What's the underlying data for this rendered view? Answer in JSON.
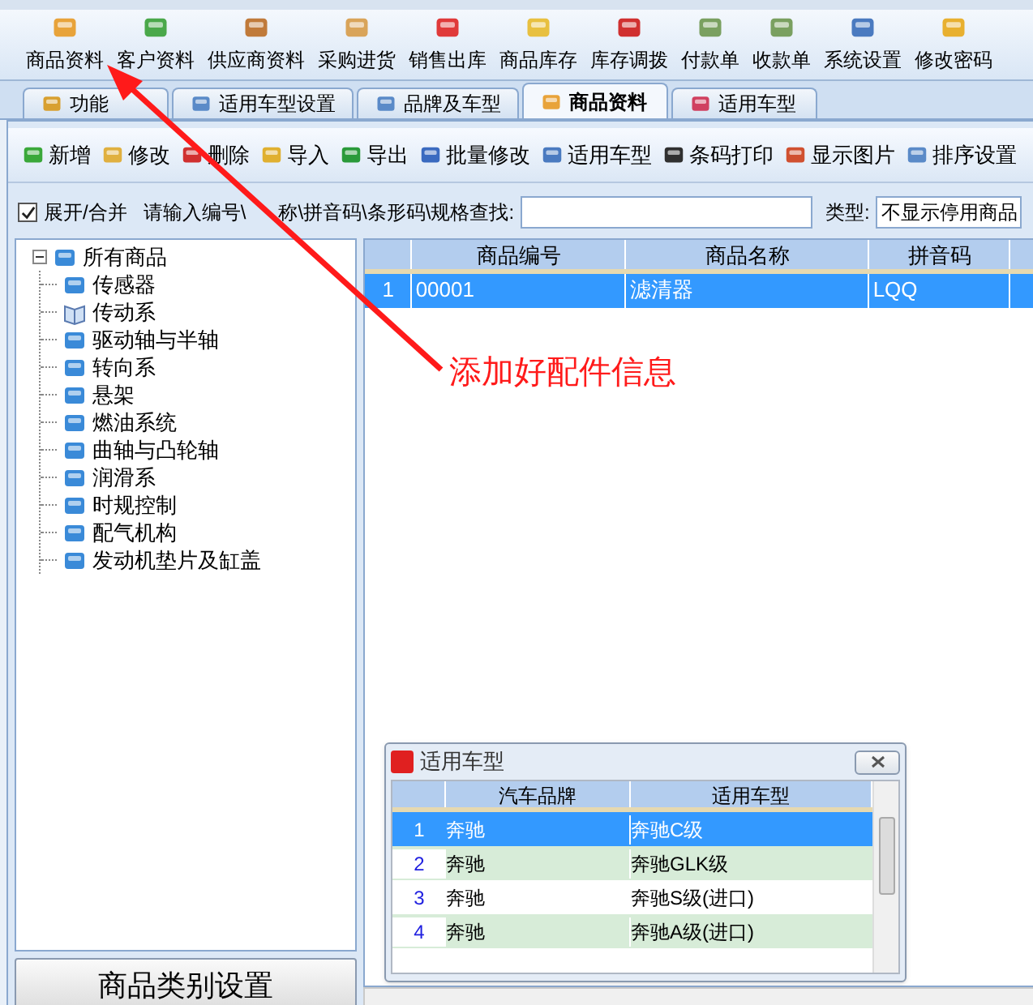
{
  "toolbar": [
    "商品资料",
    "客户资料",
    "供应商资料",
    "采购进货",
    "销售出库",
    "商品库存",
    "库存调拨",
    "付款单",
    "收款单",
    "系统设置",
    "修改密码"
  ],
  "tabs": [
    {
      "label": "功能",
      "selected": false
    },
    {
      "label": "适用车型设置",
      "selected": false
    },
    {
      "label": "品牌及车型",
      "selected": false
    },
    {
      "label": "商品资料",
      "selected": true
    },
    {
      "label": "适用车型",
      "selected": false
    }
  ],
  "actions": [
    "新增",
    "修改",
    "删除",
    "导入",
    "导出",
    "批量修改",
    "适用车型",
    "条码打印",
    "显示图片",
    "排序设置"
  ],
  "search": {
    "expand_label": "展开/合并",
    "checked": true,
    "prompt": "请输入编号\\",
    "prompt_rest": "称\\拼音码\\条形码\\规格查找:",
    "type_label": "类型:",
    "type_value": "不显示停用商品"
  },
  "tree": {
    "label": "所有商品",
    "expanded": true,
    "children": [
      {
        "label": "传感器",
        "kind": "page"
      },
      {
        "label": "传动系",
        "kind": "book"
      },
      {
        "label": "驱动轴与半轴",
        "kind": "page"
      },
      {
        "label": "转向系",
        "kind": "page"
      },
      {
        "label": "悬架",
        "kind": "page"
      },
      {
        "label": "燃油系统",
        "kind": "page"
      },
      {
        "label": "曲轴与凸轮轴",
        "kind": "page"
      },
      {
        "label": "润滑系",
        "kind": "page"
      },
      {
        "label": "时规控制",
        "kind": "page"
      },
      {
        "label": "配气机构",
        "kind": "page"
      },
      {
        "label": "发动机垫片及缸盖",
        "kind": "page"
      }
    ]
  },
  "category_button": "商品类别设置",
  "grid": {
    "columns": [
      "商品编号",
      "商品名称",
      "拼音码"
    ],
    "rows": [
      {
        "number": "1",
        "cells": [
          "00001",
          "滤清器",
          "LQQ"
        ],
        "selected": true
      }
    ]
  },
  "popup": {
    "title": "适用车型",
    "columns": [
      "汽车品牌",
      "适用车型"
    ],
    "rows": [
      {
        "number": "1",
        "brand": "奔驰",
        "model": "奔驰C级",
        "selected": true
      },
      {
        "number": "2",
        "brand": "奔驰",
        "model": "奔驰GLK级",
        "selected": false
      },
      {
        "number": "3",
        "brand": "奔驰",
        "model": "奔驰S级(进口)",
        "selected": false
      },
      {
        "number": "4",
        "brand": "奔驰",
        "model": "奔驰A级(进口)",
        "selected": false
      }
    ]
  },
  "annotation": "添加好配件信息"
}
